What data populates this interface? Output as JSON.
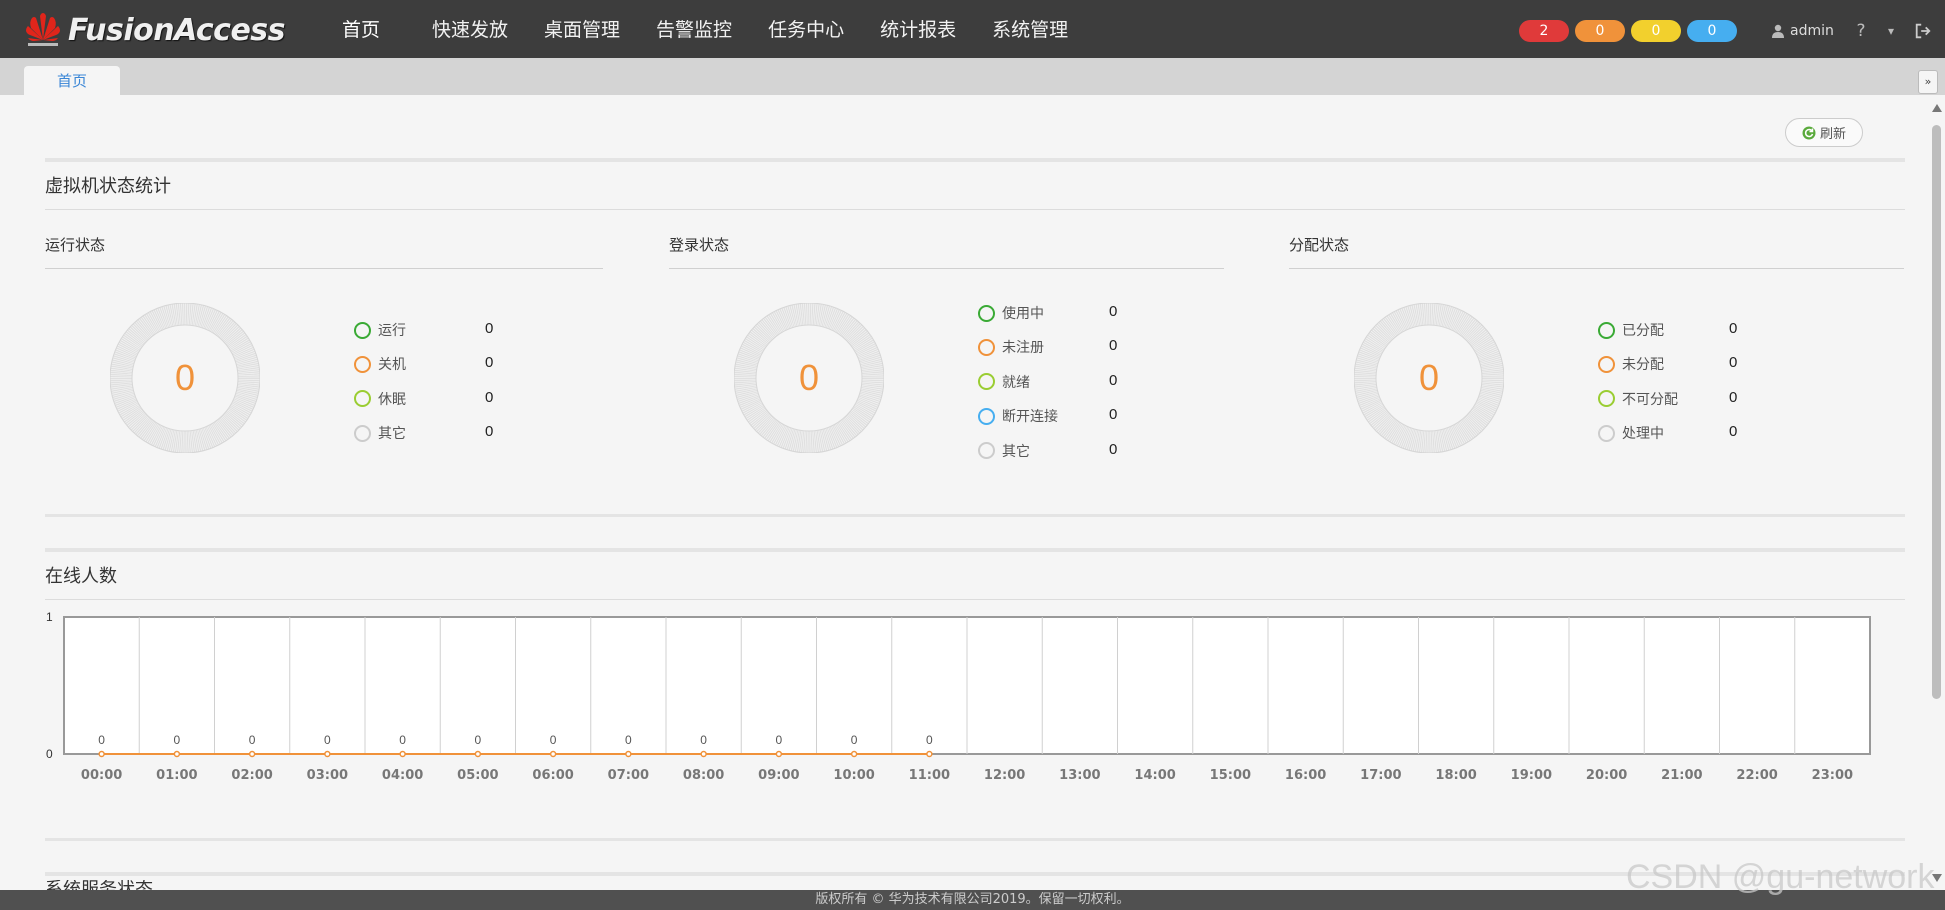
{
  "app": {
    "brand": "FusionAccess",
    "logo_icon": "huawei-logo-icon"
  },
  "nav": [
    {
      "label": "首页",
      "active": true
    },
    {
      "label": "快速发放"
    },
    {
      "label": "桌面管理"
    },
    {
      "label": "告警监控"
    },
    {
      "label": "任务中心"
    },
    {
      "label": "统计报表"
    },
    {
      "label": "系统管理"
    }
  ],
  "alarms": [
    {
      "count": "2",
      "color": "#e03a3a"
    },
    {
      "count": "0",
      "color": "#f0923a"
    },
    {
      "count": "0",
      "color": "#f2d02d"
    },
    {
      "count": "0",
      "color": "#46aef0"
    }
  ],
  "user": {
    "name": "admin",
    "help": "?",
    "menu": "▾",
    "logout_icon": "logout-icon"
  },
  "tabs": [
    {
      "label": "首页"
    }
  ],
  "refresh_label": "刷新",
  "vm_stats": {
    "title": "虚拟机状态统计",
    "groups": [
      {
        "title": "运行状态",
        "total": "0",
        "items": [
          {
            "label": "运行",
            "value": "0",
            "color": "#3aaa35"
          },
          {
            "label": "关机",
            "value": "0",
            "color": "#f0923a"
          },
          {
            "label": "休眠",
            "value": "0",
            "color": "#9acd32"
          },
          {
            "label": "其它",
            "value": "0",
            "color": "#cccccc"
          }
        ]
      },
      {
        "title": "登录状态",
        "total": "0",
        "items": [
          {
            "label": "使用中",
            "value": "0",
            "color": "#3aaa35"
          },
          {
            "label": "未注册",
            "value": "0",
            "color": "#f0923a"
          },
          {
            "label": "就绪",
            "value": "0",
            "color": "#9acd32"
          },
          {
            "label": "断开连接",
            "value": "0",
            "color": "#46aef0"
          },
          {
            "label": "其它",
            "value": "0",
            "color": "#cccccc"
          }
        ]
      },
      {
        "title": "分配状态",
        "total": "0",
        "items": [
          {
            "label": "已分配",
            "value": "0",
            "color": "#3aaa35"
          },
          {
            "label": "未分配",
            "value": "0",
            "color": "#f0923a"
          },
          {
            "label": "不可分配",
            "value": "0",
            "color": "#9acd32"
          },
          {
            "label": "处理中",
            "value": "0",
            "color": "#cccccc"
          }
        ]
      }
    ]
  },
  "online": {
    "title": "在线人数",
    "chart_data": {
      "type": "line",
      "categories": [
        "00:00",
        "01:00",
        "02:00",
        "03:00",
        "04:00",
        "05:00",
        "06:00",
        "07:00",
        "08:00",
        "09:00",
        "10:00",
        "11:00",
        "12:00",
        "13:00",
        "14:00",
        "15:00",
        "16:00",
        "17:00",
        "18:00",
        "19:00",
        "20:00",
        "21:00",
        "22:00",
        "23:00"
      ],
      "values": [
        0,
        0,
        0,
        0,
        0,
        0,
        0,
        0,
        0,
        0,
        0,
        0
      ],
      "ylim": [
        0,
        1
      ],
      "yticks": [
        "0",
        "1"
      ],
      "grid": true,
      "series_color": "#f0923a"
    }
  },
  "next_section_title": "系统服务状态",
  "footer": "版权所有 © 华为技术有限公司2019。保留一切权利。",
  "watermark": "CSDN @gu-network"
}
